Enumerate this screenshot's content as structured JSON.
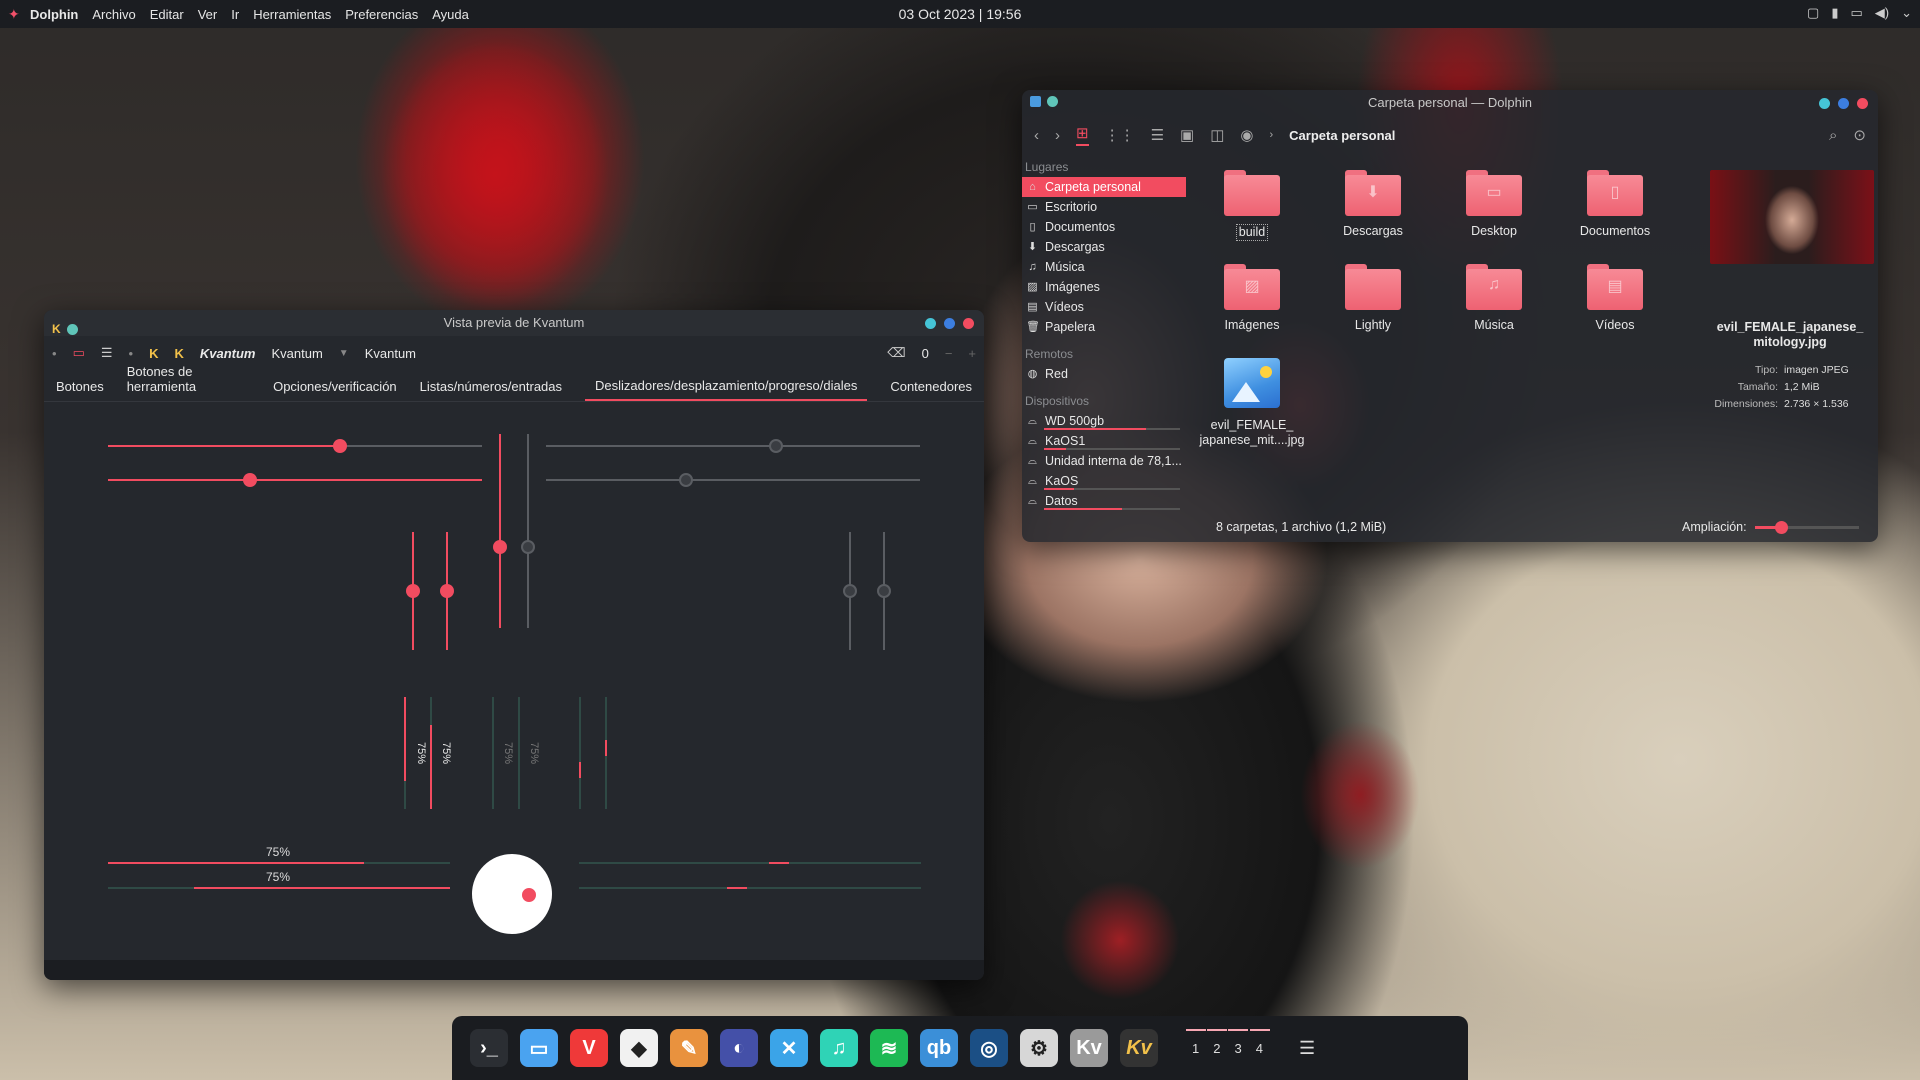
{
  "topbar": {
    "app": "Dolphin",
    "menus": [
      "Archivo",
      "Editar",
      "Ver",
      "Ir",
      "Herramientas",
      "Preferencias",
      "Ayuda"
    ],
    "clock": "03 Oct 2023 | 19:56"
  },
  "dolphin": {
    "title": "Carpeta personal — Dolphin",
    "breadcrumb": "Carpeta personal",
    "sections": {
      "places": "Lugares",
      "remote": "Remotos",
      "devices": "Dispositivos"
    },
    "places": [
      {
        "label": "Carpeta personal",
        "icon": "home-icon",
        "selected": true
      },
      {
        "label": "Escritorio",
        "icon": "desktop-icon"
      },
      {
        "label": "Documentos",
        "icon": "documents-icon"
      },
      {
        "label": "Descargas",
        "icon": "downloads-icon"
      },
      {
        "label": "Música",
        "icon": "music-icon"
      },
      {
        "label": "Imágenes",
        "icon": "pictures-icon"
      },
      {
        "label": "Vídeos",
        "icon": "videos-icon"
      },
      {
        "label": "Papelera",
        "icon": "trash-icon"
      }
    ],
    "remote": [
      {
        "label": "Red",
        "icon": "network-icon"
      }
    ],
    "devices": [
      {
        "label": "WD 500gb",
        "usage": 0.85
      },
      {
        "label": "KaOS1",
        "usage": 0.18
      },
      {
        "label": "Unidad interna de 78,1...",
        "usage": null
      },
      {
        "label": "KaOS",
        "usage": 0.25
      },
      {
        "label": "Datos",
        "usage": 0.65
      }
    ],
    "files": [
      {
        "label": "build",
        "emblem": ""
      },
      {
        "label": "Descargas",
        "emblem": "⬇"
      },
      {
        "label": "Desktop",
        "emblem": "▭"
      },
      {
        "label": "Documentos",
        "emblem": "▯"
      },
      {
        "label": "Imágenes",
        "emblem": "▨"
      },
      {
        "label": "Lightly",
        "emblem": ""
      },
      {
        "label": "Música",
        "emblem": "♫"
      },
      {
        "label": "Vídeos",
        "emblem": "▤"
      },
      {
        "label": "evil_FEMALE_\njapanese_mit....jpg",
        "emblem": "image"
      }
    ],
    "preview": {
      "name": "evil_FEMALE_japanese_\nmitology.jpg",
      "meta": [
        {
          "k": "Tipo:",
          "v": "imagen JPEG"
        },
        {
          "k": "Tamaño:",
          "v": "1,2 MiB"
        },
        {
          "k": "Dimensiones:",
          "v": "2.736 × 1.536"
        }
      ]
    },
    "status": "8 carpetas, 1 archivo (1,2 MiB)",
    "zoom_label": "Ampliación:",
    "zoom_value": 0.25
  },
  "kvantum": {
    "title": "Vista previa de Kvantum",
    "toolbar": {
      "label1": "Kvantum",
      "combo": "Kvantum",
      "label2": "Kvantum",
      "spin": "0"
    },
    "tabs": [
      "Botones",
      "Botones de herramienta",
      "Opciones/verificación",
      "Listas/números/entradas",
      "Deslizadores/desplazamiento/progreso/diales",
      "Contenedores"
    ],
    "active_tab": 4,
    "progress_label": "75%",
    "sliders": {
      "h1": 0.62,
      "h2": 0.38,
      "h3": 0.62,
      "h4": 0.38
    },
    "accent": "#f24c60"
  },
  "dock": {
    "apps": [
      "terminal",
      "file-manager",
      "vivaldi",
      "inkscape",
      "gimp",
      "kdeconnect",
      "kate",
      "music",
      "spotify",
      "qbittorrent",
      "steam",
      "system-settings",
      "kvantum-manager",
      "kvantum"
    ],
    "workspaces": [
      "1",
      "2",
      "3",
      "4"
    ]
  },
  "colors": {
    "accent": "#f24c60",
    "panel": "#1b1d21"
  }
}
